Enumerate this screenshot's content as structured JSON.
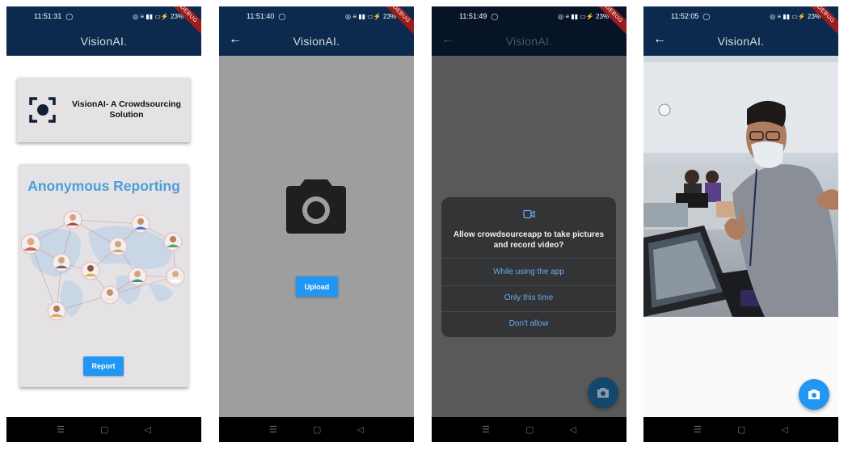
{
  "app": {
    "title": "VisionAI."
  },
  "debug_banner": "DEBUG",
  "screens": [
    {
      "status_time": "11:51:31",
      "status_icons": "◎ ≡ ▮▮ ▭⚡ 23%",
      "hero_text": "VisionAI- A Crowdsourcing Solution",
      "report_title": "Anonymous Reporting",
      "report_button": "Report"
    },
    {
      "status_time": "11:51:40",
      "status_icons": "◎ ≡ ▮▮ ▭⚡ 23%",
      "upload_button": "Upload"
    },
    {
      "status_time": "11:51:49",
      "status_icons": "◎ ≡ ▮▮ ▭⚡ 23%",
      "dialog": {
        "question": "Allow crowdsourceapp to take pictures and record video?",
        "options": [
          "While using the app",
          "Only this time",
          "Don't allow"
        ]
      }
    },
    {
      "status_time": "11:52:05",
      "status_icons": "◎ ≡ ▮▮ ▭⚡ 23%"
    }
  ],
  "icons": {
    "back": "arrow-left-icon",
    "focus": "center-focus-icon",
    "camera": "camera-icon",
    "video": "videocam-icon",
    "whatsapp": "whatsapp-icon",
    "nav_menu": "menu-icon",
    "nav_home": "square-home-icon",
    "nav_back": "triangle-back-icon"
  },
  "colors": {
    "appbar": "#0b2a4d",
    "accent": "#2196f3",
    "report_title": "#4a9ed9",
    "dialog_bg": "#333436",
    "dialog_option": "#6aaaf0"
  }
}
